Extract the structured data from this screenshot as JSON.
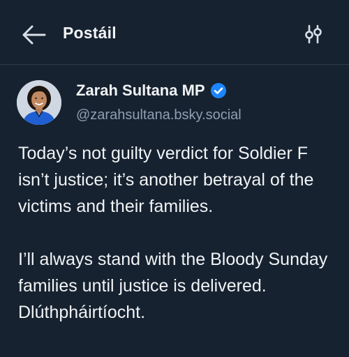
{
  "header": {
    "title": "Postáil"
  },
  "post": {
    "author_name": "Zarah Sultana MP",
    "author_handle": "@zarahsultana.bsky.social",
    "verified": true,
    "paragraphs": [
      "Today’s not guilty verdict for Soldier F isn’t justice; it’s another betrayal of the victims and their families.",
      "I’ll always stand with the Bloody Sunday families until justice is delivered. Dlúthpháirtíocht."
    ]
  },
  "icons": {
    "back": "arrow-left-icon",
    "filter": "sliders-icon",
    "verified": "verified-check-icon"
  },
  "colors": {
    "background": "#162230",
    "text": "#f1f3f5",
    "muted": "#8f9fb1",
    "verified": "#1c85ff",
    "divider": "#2b3a4b"
  }
}
